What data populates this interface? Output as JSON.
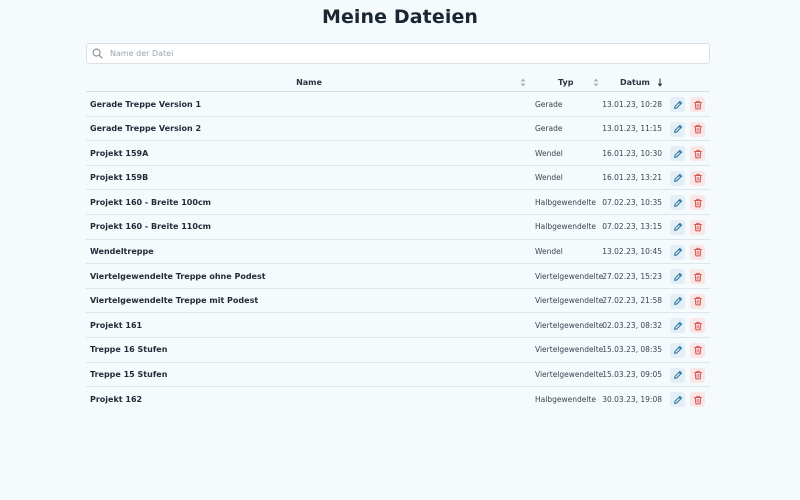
{
  "page": {
    "title": "Meine Dateien"
  },
  "search": {
    "placeholder": "Name der Datei",
    "value": ""
  },
  "table": {
    "columns": {
      "name": "Name",
      "typ": "Typ",
      "datum": "Datum"
    },
    "sort": {
      "column": "datum",
      "direction": "desc"
    },
    "rows": [
      {
        "name": "Gerade Treppe Version 1",
        "typ": "Gerade",
        "datum": "13.01.23, 10:28"
      },
      {
        "name": "Gerade Treppe Version 2",
        "typ": "Gerade",
        "datum": "13.01.23, 11:15"
      },
      {
        "name": "Projekt 159A",
        "typ": "Wendel",
        "datum": "16.01.23, 10:30"
      },
      {
        "name": "Projekt 159B",
        "typ": "Wendel",
        "datum": "16.01.23, 13:21"
      },
      {
        "name": "Projekt 160 - Breite 100cm",
        "typ": "Halbgewendelte",
        "datum": "07.02.23, 10:35"
      },
      {
        "name": "Projekt 160 - Breite 110cm",
        "typ": "Halbgewendelte",
        "datum": "07.02.23, 13:15"
      },
      {
        "name": "Wendeltreppe",
        "typ": "Wendel",
        "datum": "13.02.23, 10:45"
      },
      {
        "name": "Viertelgewendelte Treppe ohne Podest",
        "typ": "Viertelgewendelte",
        "datum": "27.02.23, 15:23"
      },
      {
        "name": "Viertelgewendelte Treppe mit Podest",
        "typ": "Viertelgewendelte",
        "datum": "27.02.23, 21:58"
      },
      {
        "name": "Projekt 161",
        "typ": "Viertelgewendelte",
        "datum": "02.03.23, 08:32"
      },
      {
        "name": "Treppe 16 Stufen",
        "typ": "Viertelgewendelte",
        "datum": "15.03.23, 08:35"
      },
      {
        "name": "Treppe 15 Stufen",
        "typ": "Viertelgewendelte",
        "datum": "15.03.23, 09:05"
      },
      {
        "name": "Projekt 162",
        "typ": "Halbgewendelte",
        "datum": "30.03.23, 19:08"
      }
    ]
  },
  "icons": {
    "search": "search-icon",
    "edit": "pencil-icon",
    "delete": "trash-icon",
    "sort": "sort-arrows-icon",
    "sort_active": "arrow-down-icon"
  },
  "colors": {
    "edit": "#1d6f9a",
    "delete": "#d9534f",
    "background": "#f5fafd"
  }
}
